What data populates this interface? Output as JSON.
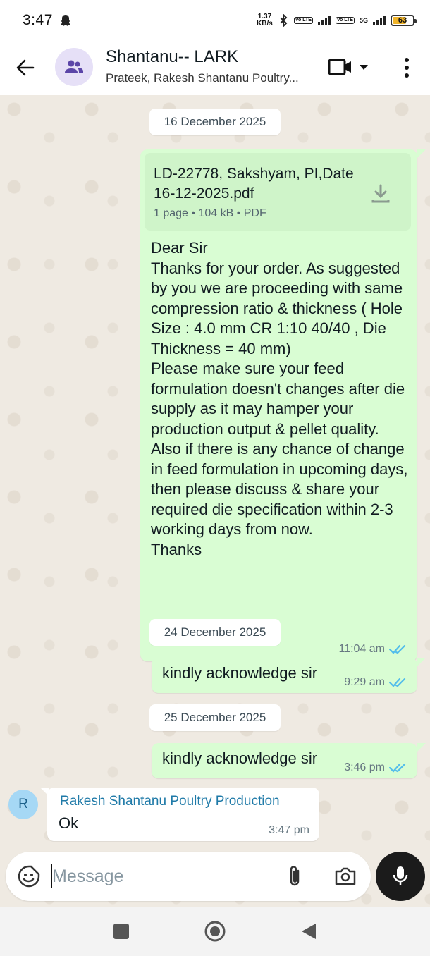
{
  "status_bar": {
    "time": "3:47",
    "net_speed_value": "1.37",
    "net_speed_unit": "KB/s",
    "volte1": "Vo LTE",
    "volte2": "Vo LTE",
    "network": "5G",
    "battery": "63"
  },
  "header": {
    "title": "Shantanu-- LARK",
    "subtitle": "Prateek, Rakesh Shantanu Poultry..."
  },
  "messages": {
    "date1": "16 December 2025",
    "doc": {
      "name": "LD-22778, Sakshyam, PI,Date 16-12-2025.pdf",
      "meta": "1 page • 104 kB • PDF"
    },
    "msg1_text": "Dear Sir\nThanks for your order. As suggested by you we are proceeding with same compression ratio & thickness ( Hole Size : 4.0 mm CR 1:10 40/40 , Die Thickness = 40 mm)\nPlease make sure your feed formulation doesn't changes after die supply as it may hamper your production output & pellet quality. Also if there is any chance of change in feed formulation in upcoming days, then please discuss & share your required die specification within 2-3 working days from now.\nThanks",
    "msg1_time": "11:04 am",
    "date2": "24 December 2025",
    "msg2_text": "kindly acknowledge sir",
    "msg2_time": "9:29 am",
    "date3": "25 December 2025",
    "msg3_text": "kindly acknowledge sir",
    "msg3_time": "3:46 pm",
    "incoming": {
      "avatar_letter": "R",
      "sender": "Rakesh Shantanu Poultry Production",
      "text": "Ok",
      "time": "3:47 pm"
    }
  },
  "input": {
    "placeholder": "Message"
  },
  "icons": {
    "back": "arrow-left-icon",
    "group_avatar": "group-icon",
    "video": "video-call-icon",
    "menu": "more-vert-icon",
    "download": "download-icon",
    "read": "double-check-icon",
    "emoji": "sticker-icon",
    "attach": "paperclip-icon",
    "camera": "camera-icon",
    "mic": "mic-icon"
  },
  "colors": {
    "outgoing_bubble": "#d9fdd3",
    "read_ticks": "#53bdeb",
    "sender_name": "#1f7aa8",
    "chat_bg": "#efeae2"
  }
}
